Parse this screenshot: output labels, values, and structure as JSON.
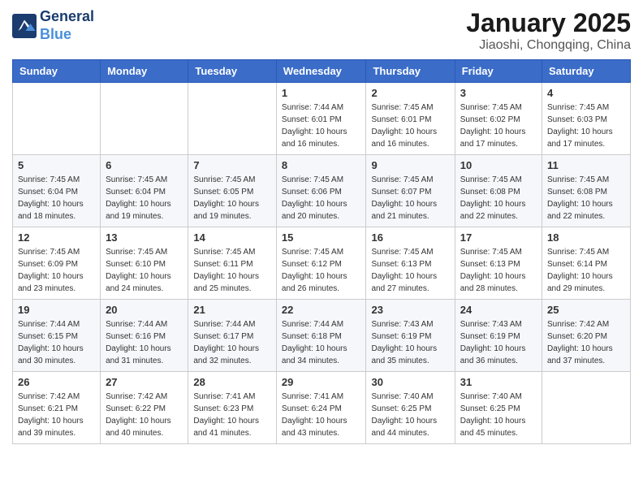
{
  "header": {
    "logo_line1": "General",
    "logo_line2": "Blue",
    "main_title": "January 2025",
    "subtitle": "Jiaoshi, Chongqing, China"
  },
  "weekdays": [
    "Sunday",
    "Monday",
    "Tuesday",
    "Wednesday",
    "Thursday",
    "Friday",
    "Saturday"
  ],
  "weeks": [
    [
      {
        "day": "",
        "info": ""
      },
      {
        "day": "",
        "info": ""
      },
      {
        "day": "",
        "info": ""
      },
      {
        "day": "1",
        "info": "Sunrise: 7:44 AM\nSunset: 6:01 PM\nDaylight: 10 hours and 16 minutes."
      },
      {
        "day": "2",
        "info": "Sunrise: 7:45 AM\nSunset: 6:01 PM\nDaylight: 10 hours and 16 minutes."
      },
      {
        "day": "3",
        "info": "Sunrise: 7:45 AM\nSunset: 6:02 PM\nDaylight: 10 hours and 17 minutes."
      },
      {
        "day": "4",
        "info": "Sunrise: 7:45 AM\nSunset: 6:03 PM\nDaylight: 10 hours and 17 minutes."
      }
    ],
    [
      {
        "day": "5",
        "info": "Sunrise: 7:45 AM\nSunset: 6:04 PM\nDaylight: 10 hours and 18 minutes."
      },
      {
        "day": "6",
        "info": "Sunrise: 7:45 AM\nSunset: 6:04 PM\nDaylight: 10 hours and 19 minutes."
      },
      {
        "day": "7",
        "info": "Sunrise: 7:45 AM\nSunset: 6:05 PM\nDaylight: 10 hours and 19 minutes."
      },
      {
        "day": "8",
        "info": "Sunrise: 7:45 AM\nSunset: 6:06 PM\nDaylight: 10 hours and 20 minutes."
      },
      {
        "day": "9",
        "info": "Sunrise: 7:45 AM\nSunset: 6:07 PM\nDaylight: 10 hours and 21 minutes."
      },
      {
        "day": "10",
        "info": "Sunrise: 7:45 AM\nSunset: 6:08 PM\nDaylight: 10 hours and 22 minutes."
      },
      {
        "day": "11",
        "info": "Sunrise: 7:45 AM\nSunset: 6:08 PM\nDaylight: 10 hours and 22 minutes."
      }
    ],
    [
      {
        "day": "12",
        "info": "Sunrise: 7:45 AM\nSunset: 6:09 PM\nDaylight: 10 hours and 23 minutes."
      },
      {
        "day": "13",
        "info": "Sunrise: 7:45 AM\nSunset: 6:10 PM\nDaylight: 10 hours and 24 minutes."
      },
      {
        "day": "14",
        "info": "Sunrise: 7:45 AM\nSunset: 6:11 PM\nDaylight: 10 hours and 25 minutes."
      },
      {
        "day": "15",
        "info": "Sunrise: 7:45 AM\nSunset: 6:12 PM\nDaylight: 10 hours and 26 minutes."
      },
      {
        "day": "16",
        "info": "Sunrise: 7:45 AM\nSunset: 6:13 PM\nDaylight: 10 hours and 27 minutes."
      },
      {
        "day": "17",
        "info": "Sunrise: 7:45 AM\nSunset: 6:13 PM\nDaylight: 10 hours and 28 minutes."
      },
      {
        "day": "18",
        "info": "Sunrise: 7:45 AM\nSunset: 6:14 PM\nDaylight: 10 hours and 29 minutes."
      }
    ],
    [
      {
        "day": "19",
        "info": "Sunrise: 7:44 AM\nSunset: 6:15 PM\nDaylight: 10 hours and 30 minutes."
      },
      {
        "day": "20",
        "info": "Sunrise: 7:44 AM\nSunset: 6:16 PM\nDaylight: 10 hours and 31 minutes."
      },
      {
        "day": "21",
        "info": "Sunrise: 7:44 AM\nSunset: 6:17 PM\nDaylight: 10 hours and 32 minutes."
      },
      {
        "day": "22",
        "info": "Sunrise: 7:44 AM\nSunset: 6:18 PM\nDaylight: 10 hours and 34 minutes."
      },
      {
        "day": "23",
        "info": "Sunrise: 7:43 AM\nSunset: 6:19 PM\nDaylight: 10 hours and 35 minutes."
      },
      {
        "day": "24",
        "info": "Sunrise: 7:43 AM\nSunset: 6:19 PM\nDaylight: 10 hours and 36 minutes."
      },
      {
        "day": "25",
        "info": "Sunrise: 7:42 AM\nSunset: 6:20 PM\nDaylight: 10 hours and 37 minutes."
      }
    ],
    [
      {
        "day": "26",
        "info": "Sunrise: 7:42 AM\nSunset: 6:21 PM\nDaylight: 10 hours and 39 minutes."
      },
      {
        "day": "27",
        "info": "Sunrise: 7:42 AM\nSunset: 6:22 PM\nDaylight: 10 hours and 40 minutes."
      },
      {
        "day": "28",
        "info": "Sunrise: 7:41 AM\nSunset: 6:23 PM\nDaylight: 10 hours and 41 minutes."
      },
      {
        "day": "29",
        "info": "Sunrise: 7:41 AM\nSunset: 6:24 PM\nDaylight: 10 hours and 43 minutes."
      },
      {
        "day": "30",
        "info": "Sunrise: 7:40 AM\nSunset: 6:25 PM\nDaylight: 10 hours and 44 minutes."
      },
      {
        "day": "31",
        "info": "Sunrise: 7:40 AM\nSunset: 6:25 PM\nDaylight: 10 hours and 45 minutes."
      },
      {
        "day": "",
        "info": ""
      }
    ]
  ]
}
